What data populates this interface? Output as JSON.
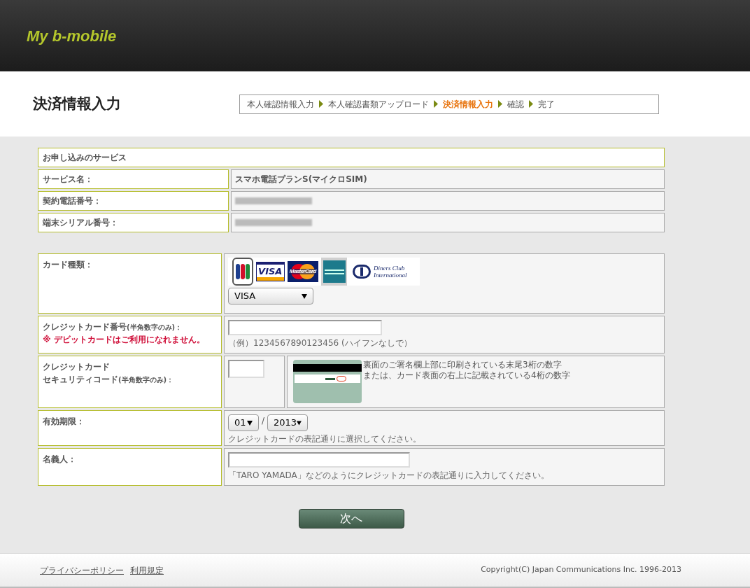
{
  "header": {
    "logo": "My b-mobile"
  },
  "page_title": "決済情報入力",
  "steps": [
    {
      "label": "本人確認情報入力",
      "selected": false
    },
    {
      "label": "本人確認書類アップロード",
      "selected": false
    },
    {
      "label": "決済情報入力",
      "selected": true
    },
    {
      "label": "確認",
      "selected": false
    },
    {
      "label": "完了",
      "selected": false
    }
  ],
  "service_table": {
    "heading": "お申し込みのサービス",
    "rows": [
      {
        "label": "サービス名：",
        "value": "スマホ電話プランS(マイクロSIM)",
        "redacted": false
      },
      {
        "label": "契約電話番号：",
        "redacted": true
      },
      {
        "label": "端末シリアル番号：",
        "redacted": true
      }
    ]
  },
  "card_form": {
    "card_type": {
      "label": "カード種類：",
      "logos": [
        {
          "kind": "jcb"
        },
        {
          "kind": "visa",
          "text": "VISA"
        },
        {
          "kind": "mastercard",
          "text": "MasterCard"
        },
        {
          "kind": "amex"
        },
        {
          "kind": "diners",
          "text": "Diners Club International"
        }
      ],
      "select_value": "VISA"
    },
    "card_number": {
      "label": "クレジットカード番号",
      "label_note": "(半角数字のみ)：",
      "warning": "※ デビットカードはご利用になれません。",
      "hint": "（例）1234567890123456 (ハイフンなしで）"
    },
    "security_code": {
      "label_line1": "クレジットカード",
      "label_line2": "セキュリティコード",
      "label_note": "(半角数字のみ)：",
      "help": [
        "裏面のご署名欄上部に印刷されている末尾3桁の数字",
        "または、カード表面の右上に記載されている4桁の数字"
      ]
    },
    "expiry": {
      "label": "有効期限：",
      "month": "01",
      "separator": "/",
      "year": "2013",
      "hint": "クレジットカードの表記通りに選択してください。"
    },
    "holder": {
      "label": "名義人：",
      "hint": "「TARO YAMADA」などのようにクレジットカードの表記通りに入力してください。"
    }
  },
  "next_button": "次へ",
  "footer": {
    "links": [
      "プライバシーポリシー",
      "利用規定"
    ],
    "copyright": "Copyright(C) Japan Communications Inc. 1996-2013"
  }
}
